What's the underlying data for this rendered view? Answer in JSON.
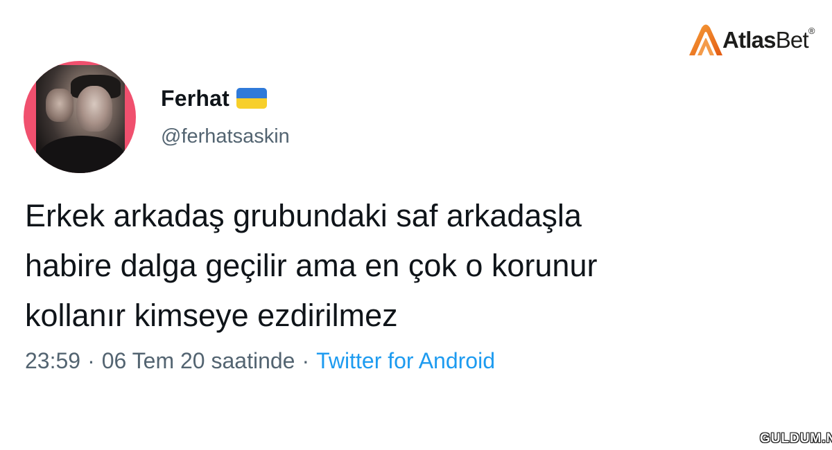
{
  "logo": {
    "text_bold": "Atlas",
    "text_regular": "Bet",
    "registered_mark": "®",
    "icon": "atlasbet-arch-logo-icon"
  },
  "tweet": {
    "author": {
      "display_name": "Ferhat",
      "handle": "@ferhatsaskin",
      "flag_icon": "ukraine-flag-icon",
      "avatar_ring_color": "#f0506e"
    },
    "text_lines": [
      "Erkek arkadaş grubundaki saf arkadaşla",
      "habire dalga geçilir ama en çok o korunur",
      "kollanır kimseye ezdirilmez"
    ],
    "time": "23:59",
    "date": "06 Tem 20 saatinde",
    "separator": "·",
    "source": "Twitter for Android",
    "colors": {
      "text": "#0f1419",
      "secondary": "#536471",
      "link": "#1d9bf0"
    }
  },
  "watermark": {
    "text": "GULDUM.NET"
  }
}
